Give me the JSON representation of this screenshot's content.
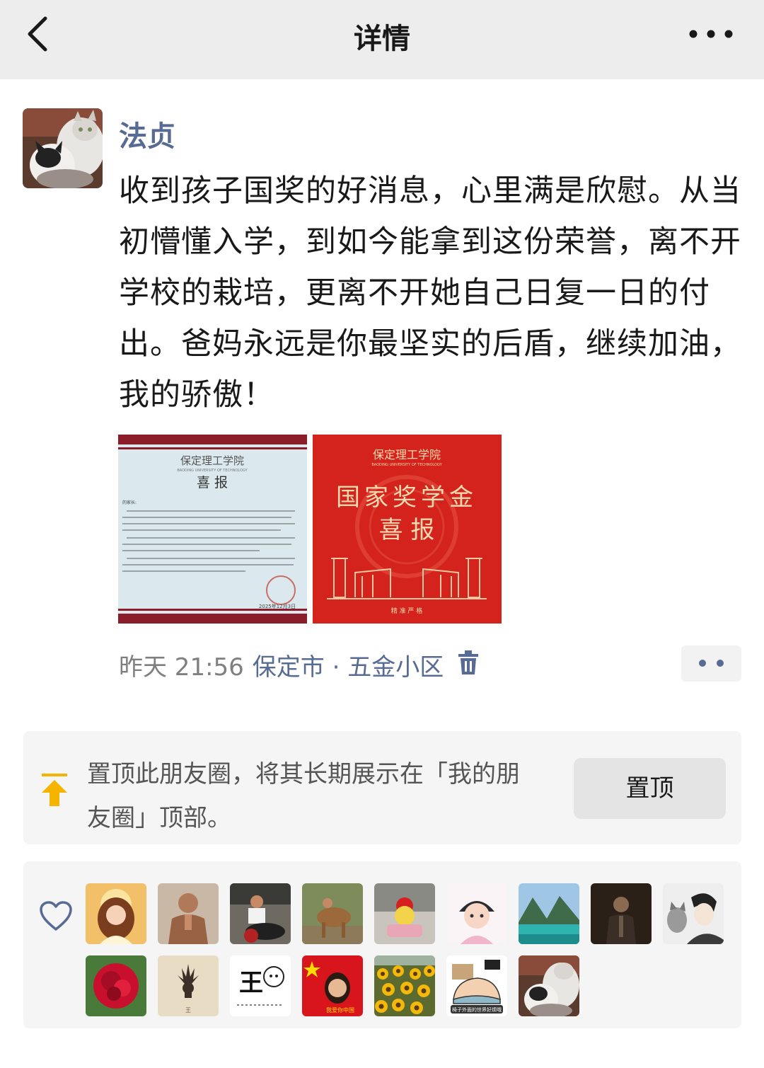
{
  "header": {
    "title": "详情"
  },
  "post": {
    "author": "法贞",
    "text": "收到孩子国奖的好消息，心里满是欣慰。从当初懵懂入学，到如今能拿到这份荣誉，离不开学校的栽培，更离不开她自己日复一日的付出。爸妈永远是你最坚实的后盾，继续加油，我的骄傲！",
    "photos": [
      {
        "school": "保定理工学院",
        "school_en": "BAODING UNIVERSITY OF TECHNOLOGY",
        "heading": "喜  报",
        "salutation": "的家长:",
        "date": "2025年12月3日"
      },
      {
        "school": "保定理工学院",
        "school_en": "BAODING UNIVERSITY OF TECHNOLOGY",
        "title": "国家奖学金",
        "subtitle": "喜  报",
        "footer": "精 准 严 格"
      }
    ],
    "time": "昨天 21:56",
    "location": "保定市 · 五金小区"
  },
  "pin": {
    "text": "置顶此朋友圈，将其长期展示在「我的朋友圈」顶部。",
    "button_label": "置顶"
  },
  "likes": {
    "avatars": [
      "avatar-cartoon-girl",
      "avatar-man-praying",
      "avatar-man-motorcycle",
      "avatar-camel",
      "avatar-flower-pot",
      "avatar-anime-character",
      "avatar-mountain-lake",
      "avatar-dark-portrait",
      "avatar-anime-boy-cat",
      "avatar-red-carnation",
      "avatar-beige-symbol",
      "avatar-wang-character",
      "avatar-flag-woman",
      "avatar-sunflowers",
      "avatar-sleeping-cartoon",
      "avatar-cats"
    ],
    "avatar_texts": {
      "wang": "王",
      "flag_caption": "我爱你中国",
      "cartoon_caption": "椅子外面的世界好烦哦"
    }
  },
  "colors": {
    "link": "#576b95",
    "pin_icon": "#f5b400",
    "background": "#ffffff",
    "header_bg": "#ededed"
  }
}
